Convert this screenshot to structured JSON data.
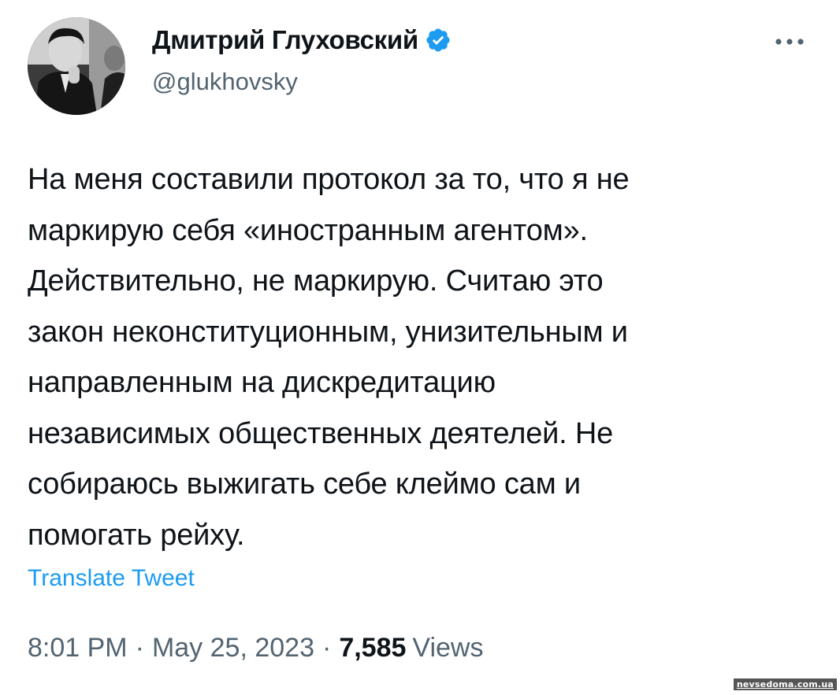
{
  "author": {
    "display_name": "Дмитрий Глуховский",
    "handle": "@glukhovsky",
    "verified": true,
    "avatar_icon": "avatar-photo",
    "verified_icon": "verified-badge-icon",
    "verified_color": "#1d9bf0"
  },
  "more_icon": "more-options-icon",
  "tweet": {
    "lines": [
      "На меня составили протокол за то, что я не",
      "маркирую себя «иностранным агентом».",
      "Действительно, не маркирую. Считаю это",
      "закон неконституционным, унизительным и",
      "направленным на дискредитацию",
      "независимых общественных деятелей. Не",
      "собираюсь выжигать себе клеймо сам и",
      "помогать рейху."
    ],
    "translate_label": "Translate Tweet"
  },
  "meta": {
    "time": "8:01 PM",
    "separator": "·",
    "date": "May 25, 2023",
    "views_count": "7,585",
    "views_label": "Views"
  },
  "watermark": "nevsedoma.com.ua",
  "colors": {
    "text": "#0f1419",
    "secondary": "#536471",
    "link": "#1d9bf0"
  }
}
